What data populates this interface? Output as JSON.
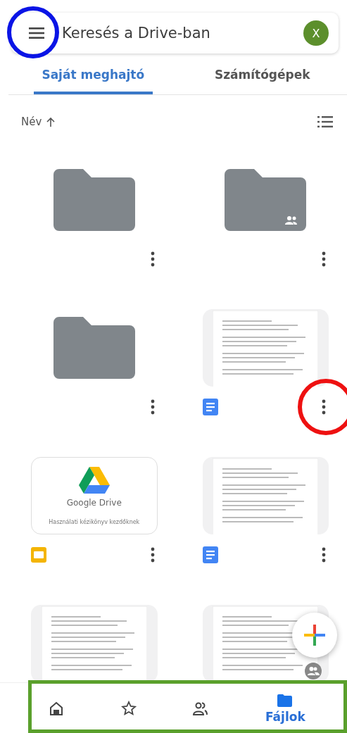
{
  "search_bar": {
    "placeholder": "Keresés a Drive-ban",
    "avatar": "X",
    "menu_highlight": {
      "color": "#0a14e6"
    }
  },
  "tabs": [
    {
      "label": "Saját meghajtó",
      "selected": true
    },
    {
      "label": "Számítógépek",
      "selected": false
    }
  ],
  "sort": {
    "label": "Név"
  },
  "items": [
    {
      "kind": "folder",
      "shared": false
    },
    {
      "kind": "folder",
      "shared": true
    },
    {
      "kind": "folder",
      "shared": false
    },
    {
      "kind": "doc",
      "shared": false,
      "highlight": {
        "color": "#ee1111"
      }
    },
    {
      "kind": "slides",
      "shared": false,
      "preview_title": "Google Drive",
      "preview_text": "Használati kézikönyv kezdőknek"
    },
    {
      "kind": "doc",
      "shared": false
    },
    {
      "kind": "doc",
      "shared": false,
      "footer_hidden": true
    },
    {
      "kind": "doc",
      "shared": true,
      "footer_hidden": true
    }
  ],
  "bottom_nav": [
    {
      "kind": "home",
      "selected": false
    },
    {
      "kind": "starred",
      "selected": false
    },
    {
      "kind": "shared",
      "selected": false
    },
    {
      "kind": "files",
      "label": "Fájlok",
      "selected": true
    }
  ],
  "bottom_nav_highlight": {
    "color": "#5aa02c"
  }
}
